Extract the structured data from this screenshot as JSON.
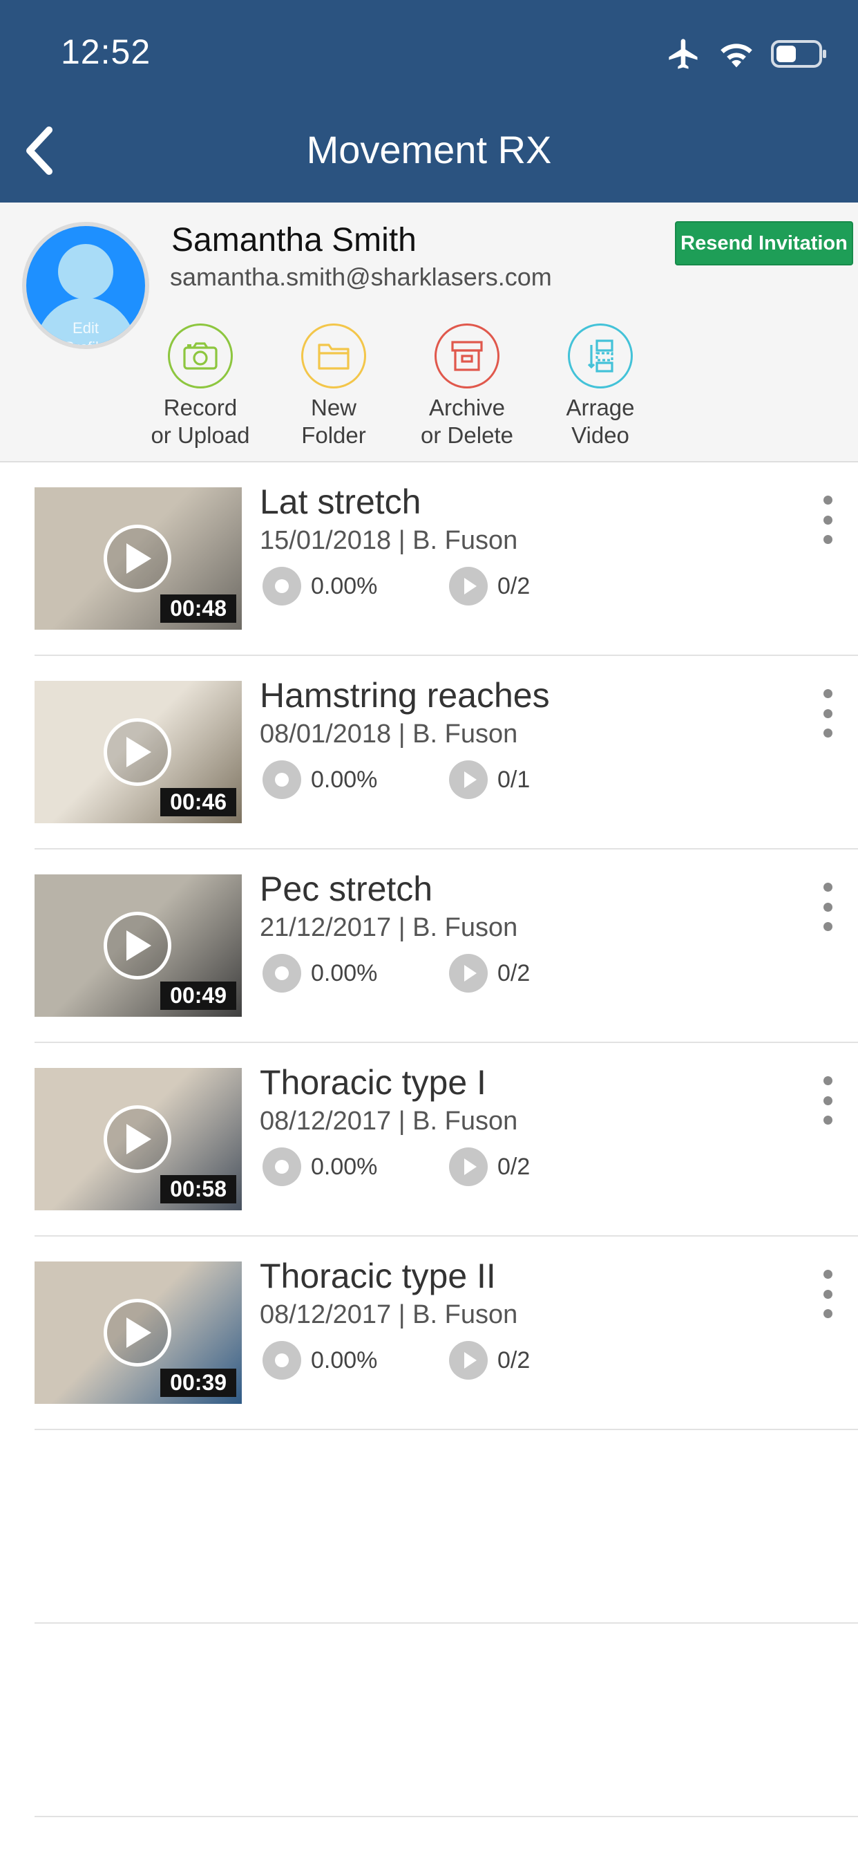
{
  "status": {
    "time": "12:52"
  },
  "header": {
    "title": "Movement RX"
  },
  "profile": {
    "name": "Samantha Smith",
    "email": "samantha.smith@sharklasers.com",
    "edit_label": "Edit\nProfile",
    "resend_label": "Resend Invitation"
  },
  "actions": [
    {
      "label": "Record\nor Upload",
      "color": "#8dc63f",
      "icon": "camera-icon"
    },
    {
      "label": "New\nFolder",
      "color": "#f3c64a",
      "icon": "folder-icon"
    },
    {
      "label": "Archive\nor Delete",
      "color": "#e0584c",
      "icon": "archive-box-icon"
    },
    {
      "label": "Arrage\nVideo",
      "color": "#43c2d8",
      "icon": "arrange-icon"
    }
  ],
  "videos": [
    {
      "title": "Lat stretch",
      "meta": "15/01/2018 | B. Fuson",
      "duration": "00:48",
      "progress": "0.00%",
      "plays": "0/2",
      "thumb_colors": [
        "#c9c1b3",
        "#6d6a64"
      ]
    },
    {
      "title": "Hamstring reaches",
      "meta": "08/01/2018 | B. Fuson",
      "duration": "00:46",
      "progress": "0.00%",
      "plays": "0/1",
      "thumb_colors": [
        "#e7e1d6",
        "#7c7260"
      ]
    },
    {
      "title": "Pec stretch",
      "meta": "21/12/2017 | B. Fuson",
      "duration": "00:49",
      "progress": "0.00%",
      "plays": "0/2",
      "thumb_colors": [
        "#b8b3a8",
        "#3f3f3f"
      ]
    },
    {
      "title": "Thoracic type I",
      "meta": "08/12/2017 | B. Fuson",
      "duration": "00:58",
      "progress": "0.00%",
      "plays": "0/2",
      "thumb_colors": [
        "#d4cbbd",
        "#47515e"
      ]
    },
    {
      "title": "Thoracic type II",
      "meta": "08/12/2017 | B. Fuson",
      "duration": "00:39",
      "progress": "0.00%",
      "plays": "0/2",
      "thumb_colors": [
        "#cfc6b8",
        "#2f5a86"
      ]
    }
  ]
}
